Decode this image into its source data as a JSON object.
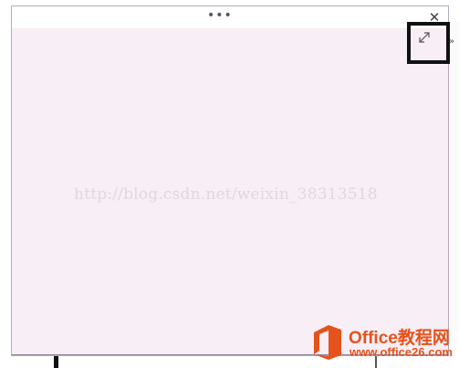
{
  "window": {
    "menu_dots": "•••",
    "close_glyph": "✕",
    "expand_icon": "expand-diagonal-icon"
  },
  "content": {
    "watermark": "http://blog.csdn.net/weixin_38313518"
  },
  "logo": {
    "title": "Office教程网",
    "url": "www.office26.com"
  },
  "background": {
    "edge_glyph": "»"
  },
  "colors": {
    "content_bg": "#f7eef6",
    "logo_orange": "#e5531c",
    "highlight": "#111111"
  }
}
